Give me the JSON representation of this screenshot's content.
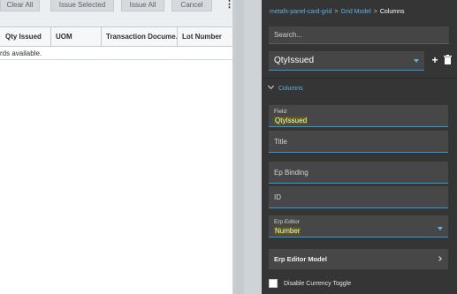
{
  "toolbar": {
    "clear_all": "Clear All",
    "issue_selected": "Issue Selected",
    "issue_all": "Issue All",
    "cancel": "Cancel",
    "more": "⋮"
  },
  "grid": {
    "columns": [
      "Qty Issued",
      "UOM",
      "Transaction Docume...",
      "Lot Number"
    ],
    "empty_message": "rds available."
  },
  "panel": {
    "breadcrumb": {
      "root": "metafx-panel-card-grid",
      "middle": "Grid Model",
      "current": "Columns",
      "separator": ">"
    },
    "search_placeholder": "Search...",
    "selected_column": "QtyIssued",
    "add_label": "+",
    "section_title": "Columns",
    "fields": {
      "field_label": "Field",
      "field_value": "QtyIssued",
      "title_label": "Title",
      "ep_binding_label": "Ep Binding",
      "id_label": "ID",
      "erp_editor_label": "Erp Editor",
      "erp_editor_value": "Number"
    },
    "erp_editor_model": "Erp Editor Model",
    "disable_currency_toggle": "Disable Currency Toggle"
  },
  "colors": {
    "panel_bg": "#353535",
    "accent": "#2e9ad8",
    "link": "#5fb3e6",
    "highlight": "#5b5a14"
  }
}
